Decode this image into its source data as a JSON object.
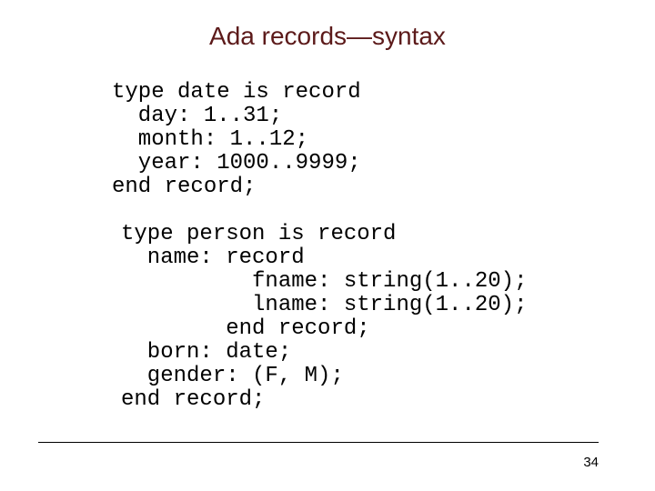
{
  "slide": {
    "title": "Ada records—syntax",
    "page_number": "34",
    "title_color": "#5c1a1a"
  },
  "code_blocks": [
    {
      "lines": [
        "type date is record",
        "  day: 1..31;",
        "  month: 1..12;",
        "  year: 1000..9999;",
        "end record;"
      ]
    },
    {
      "lines": [
        "type person is record",
        "  name: record",
        "          fname: string(1..20);",
        "          lname: string(1..20);",
        "        end record;",
        "  born: date;",
        "  gender: (F, M);",
        "end record;"
      ]
    }
  ]
}
